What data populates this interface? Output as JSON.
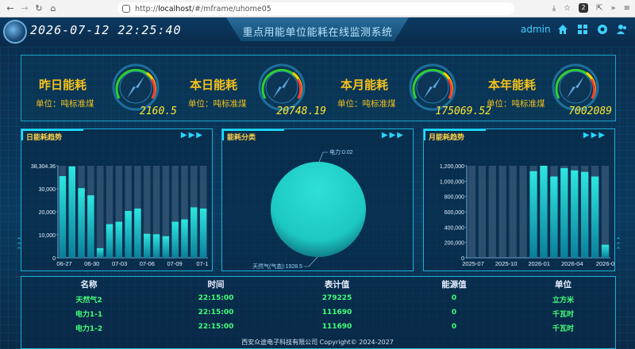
{
  "browser": {
    "url_prefix": "http://",
    "url_host": "localhost",
    "url_path": "/#/mframe/uhome05",
    "badge": "2"
  },
  "header": {
    "datetime": "2026-07-12 22:25:40",
    "title": "重点用能单位能耗在线监测系统",
    "user": "admin",
    "icons": [
      "home-icon",
      "grid-icon",
      "settings-icon",
      "users-icon"
    ]
  },
  "kpis": [
    {
      "label": "昨日能耗",
      "unit": "单位：吨标准煤",
      "value": "2160.5"
    },
    {
      "label": "本日能耗",
      "unit": "单位：吨标准煤",
      "value": "20748.19"
    },
    {
      "label": "本月能耗",
      "unit": "单位：吨标准煤",
      "value": "175069.52"
    },
    {
      "label": "本年能耗",
      "unit": "单位：吨标准煤",
      "value": "7002089"
    }
  ],
  "panels": {
    "daily_title": "日能耗趋势",
    "category_title": "能耗分类",
    "monthly_title": "月能耗趋势",
    "arrows": "▶▶▶"
  },
  "chart_data": [
    {
      "type": "bar",
      "title": "日能耗趋势",
      "ylim": [
        0,
        38304.36
      ],
      "yticks": [
        "38,304.36",
        "30,000",
        "20,000",
        "10,000",
        "0"
      ],
      "xticks": [
        "06-27",
        "06-30",
        "07-03",
        "07-06",
        "07-09",
        "07-1"
      ],
      "values": [
        34000,
        38000,
        29000,
        26000,
        4000,
        14000,
        15000,
        19500,
        20500,
        10000,
        9800,
        9000,
        15000,
        16000,
        21000,
        20500
      ],
      "max": 38304.36,
      "colors": {
        "bar": "#22d3d0",
        "background_bar": "#4a6a88"
      }
    },
    {
      "type": "pie",
      "title": "能耗分类",
      "slices": [
        {
          "name": "电力",
          "value": 0.02,
          "label": "电力:0.02"
        },
        {
          "name": "天然气(气态)",
          "value": 1928.5,
          "label": "天然气(气态):1928.5"
        }
      ],
      "colors": {
        "main": "#1cc8c2"
      }
    },
    {
      "type": "bar",
      "title": "月能耗趋势",
      "ylim": [
        0,
        1200000
      ],
      "yticks": [
        "1,200,000",
        "1,000,000",
        "800,000",
        "600,000",
        "400,000",
        "200,000",
        "0"
      ],
      "xticks": [
        "2025-07",
        "2025-10",
        "2026-01",
        "2026-04",
        "2026-0"
      ],
      "values": [
        0,
        0,
        0,
        0,
        0,
        0,
        1130000,
        1200000,
        1060000,
        1170000,
        1140000,
        1120000,
        1060000,
        170000
      ],
      "max": 1200000,
      "colors": {
        "bar": "#22d3d0",
        "background_bar": "#4a6a88"
      }
    }
  ],
  "table": {
    "headers": [
      "名称",
      "时间",
      "表计值",
      "能源值",
      "单位"
    ],
    "rows": [
      [
        "天然气2",
        "22:15:00",
        "279225",
        "0",
        "立方米"
      ],
      [
        "电力1-1",
        "22:15:00",
        "111690",
        "0",
        "千瓦时"
      ],
      [
        "电力1-2",
        "22:15:00",
        "111690",
        "0",
        "千瓦时"
      ]
    ]
  },
  "footer": "西安众途电子科技有限公司 Copyright© 2024-2027"
}
